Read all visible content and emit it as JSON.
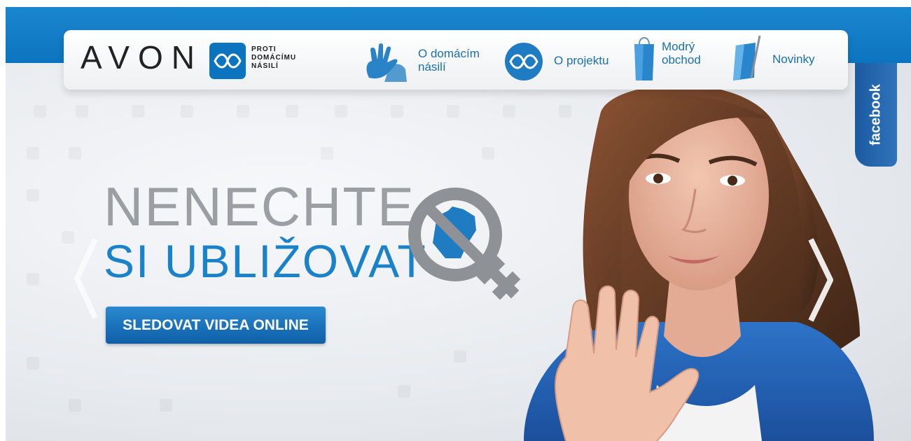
{
  "brand": {
    "logo_text": "AVON",
    "tagline_lines": [
      "PROTI",
      "DOMÁCÍMU",
      "NÁSILÍ"
    ]
  },
  "nav": {
    "items": [
      {
        "label": "O domácím\nnásilí",
        "icon": "raised-hand-icon"
      },
      {
        "label": "O projektu",
        "icon": "infinity-ribbon-icon"
      },
      {
        "label": "Modrý\nobchod",
        "icon": "shopping-bag-icon"
      },
      {
        "label": "Novinky",
        "icon": "pen-notebook-icon"
      }
    ]
  },
  "hero": {
    "headline_line1": "NENECHTE",
    "headline_line2": "SI UBLIŽOVAT",
    "emblem_icon": "no-fist-female-symbol-icon",
    "cta_label": "SLEDOVAT VIDEA ONLINE"
  },
  "facebook": {
    "label": "facebook"
  },
  "colors": {
    "brand_blue": "#0c74bf",
    "text_blue": "#1a82c9",
    "headline_grey": "#9b9ea3",
    "facebook_blue": "#1b5aa0"
  }
}
